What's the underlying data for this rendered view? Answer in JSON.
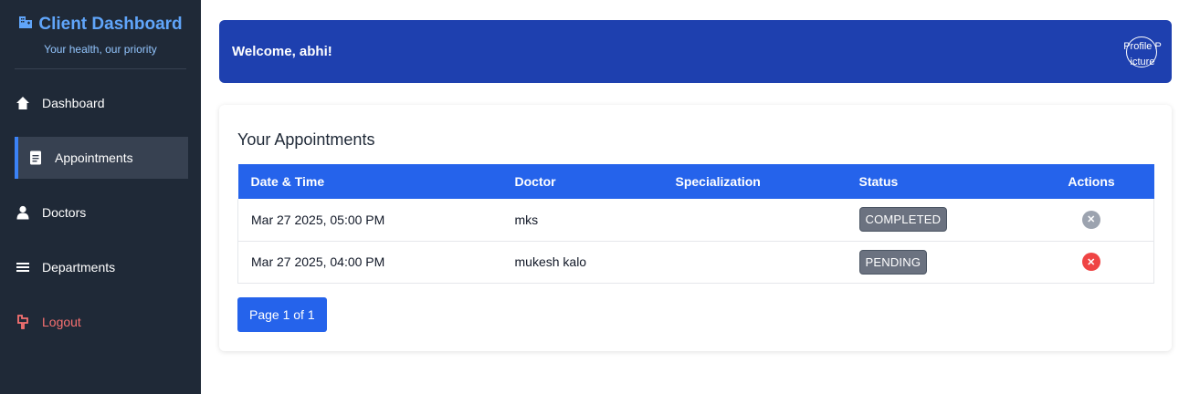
{
  "sidebar": {
    "brand_title": "Client Dashboard",
    "brand_icon": "hospital-icon",
    "tagline": "Your health, our priority",
    "items": [
      {
        "label": "Dashboard",
        "icon": "home-icon"
      },
      {
        "label": "Appointments",
        "icon": "file-icon",
        "active": true
      },
      {
        "label": "Doctors",
        "icon": "user-doctor-icon"
      },
      {
        "label": "Departments",
        "icon": "menu-icon"
      },
      {
        "label": "Logout",
        "icon": "logout-icon"
      }
    ]
  },
  "header": {
    "welcome": "Welcome, abhi!",
    "profile_alt": "Profile Picture"
  },
  "appointments": {
    "title": "Your Appointments",
    "columns": [
      "Date & Time",
      "Doctor",
      "Specialization",
      "Status",
      "Actions"
    ],
    "rows": [
      {
        "datetime": "Mar 27 2025, 05:00 PM",
        "doctor": "mks",
        "specialization": "",
        "status": "COMPLETED",
        "action_color": "#9ca3af"
      },
      {
        "datetime": "Mar 27 2025, 04:00 PM",
        "doctor": "mukesh kalo",
        "specialization": "",
        "status": "PENDING",
        "action_color": "#ef4444"
      }
    ],
    "pagination": "Page 1 of 1"
  },
  "colors": {
    "sidebar_bg": "#1f2937",
    "header_bg": "#1e40af",
    "table_header_bg": "#2563eb",
    "brand": "#60a5fa",
    "logout": "#f87171"
  }
}
